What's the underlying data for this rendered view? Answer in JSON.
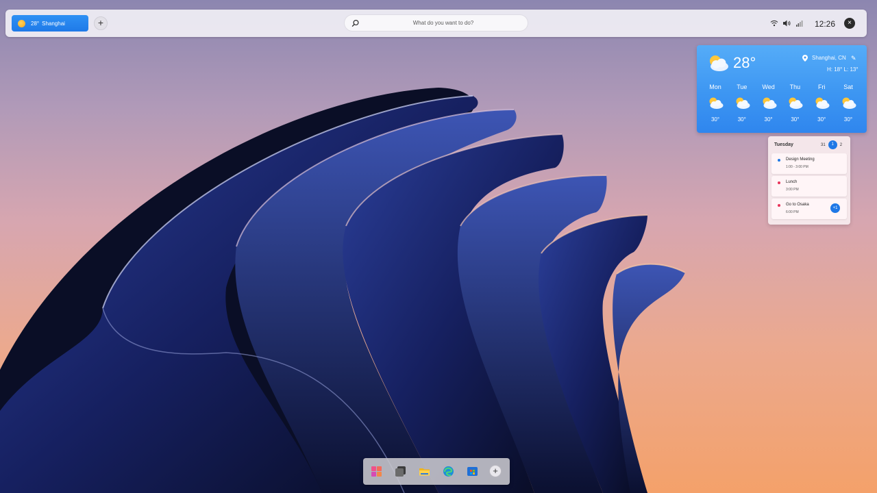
{
  "topbar": {
    "weather_pill": {
      "temp": "28°",
      "city": "Shanghai"
    },
    "add_widget_label": "+",
    "search": {
      "placeholder": "What do you want to do?"
    },
    "tray": {
      "icons": [
        "wifi-icon",
        "volume-icon",
        "signal-icon"
      ]
    },
    "clock": "12:26",
    "power_glyph": "×"
  },
  "weather_widget": {
    "temp": "28°",
    "location": "Shanghai, CN",
    "high_low": "H: 18° L: 13°",
    "forecast": [
      {
        "day": "Mon",
        "temp": "30°"
      },
      {
        "day": "Tue",
        "temp": "30°"
      },
      {
        "day": "Wed",
        "temp": "30°"
      },
      {
        "day": "Thu",
        "temp": "30°"
      },
      {
        "day": "Fri",
        "temp": "30°"
      },
      {
        "day": "Sat",
        "temp": "30°"
      }
    ],
    "colors": {
      "top": "#55acf8",
      "bottom": "#2f86ee"
    }
  },
  "calendar_widget": {
    "day_label": "Tuesday",
    "dates": {
      "prev": "31",
      "current": "1",
      "next": "2"
    },
    "events": [
      {
        "title": "Design Meeting",
        "time": "1:00 - 3:00 PM",
        "color": "#1f78e6"
      },
      {
        "title": "Lunch",
        "time": "3:00 PM",
        "color": "#e8345a"
      },
      {
        "title": "Go to Osaka",
        "time": "6:00 PM",
        "color": "#e8345a",
        "more": "+1"
      }
    ]
  },
  "dock": {
    "items": [
      "start-icon",
      "task-view-icon",
      "file-explorer-icon",
      "edge-icon",
      "store-icon"
    ],
    "add_label": "+"
  }
}
